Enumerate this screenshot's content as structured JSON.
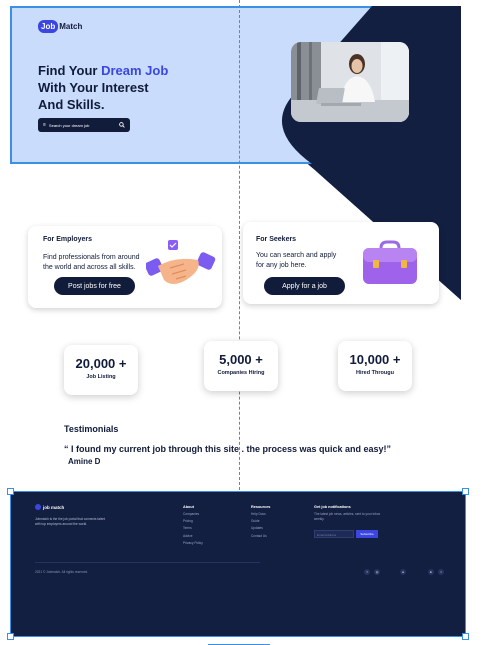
{
  "colors": {
    "navy": "#111b3a",
    "accent": "#3b46e0",
    "hero_bg": "#c9dcfb",
    "selection": "#3b8fe5"
  },
  "header": {
    "logo_badge": "Job",
    "logo_rest": "Match"
  },
  "hero": {
    "title_line1_pre": "Find Your ",
    "title_line1_accent": "Dream Job",
    "title_line2": "With Your Interest",
    "title_line3": "And Skills.",
    "search_placeholder": "Search your dream job"
  },
  "cards": {
    "employers": {
      "title": "For Employers",
      "text_line1": "Find professionals from around",
      "text_line2": "the world and across all skills.",
      "button": "Post jobs for free"
    },
    "seekers": {
      "title": "For Seekers",
      "text_line1": "You can search and apply",
      "text_line2": "for any job here.",
      "button": "Apply for a job"
    }
  },
  "stats": [
    {
      "number": "20,000 +",
      "label": "Job Listing"
    },
    {
      "number": "5,000 +",
      "label": "Companies Hiring"
    },
    {
      "number": "10,000 +",
      "label": "Hired Througu"
    }
  ],
  "testimonials": {
    "heading": "Testimonials",
    "quote": "“ I found my current job through this site . the process was quick and easy!”",
    "author": "Amine D"
  },
  "footer": {
    "logo": "job match",
    "description": "Jobmatch is the the job portal that connects talent with top employers around the world.",
    "about": {
      "heading": "About",
      "items": [
        "Companies",
        "Pricing",
        "Terms",
        "Advice",
        "Privacy Policy"
      ]
    },
    "resources": {
      "heading": "Resources",
      "items": [
        "Help Docs",
        "Guide",
        "Updates",
        "Contact Us"
      ]
    },
    "newsletter": {
      "heading": "Get job notifications",
      "description": "The latest job news, articles, sent to your inbox weekly.",
      "email_placeholder": "Email Address",
      "subscribe": "Subscribe"
    },
    "copyright": "2021 © Jobmatch. All rights reserved.",
    "social_icons": [
      "facebook-icon",
      "instagram-icon",
      "dribbble-icon",
      "linkedin-icon",
      "twitter-icon"
    ]
  }
}
